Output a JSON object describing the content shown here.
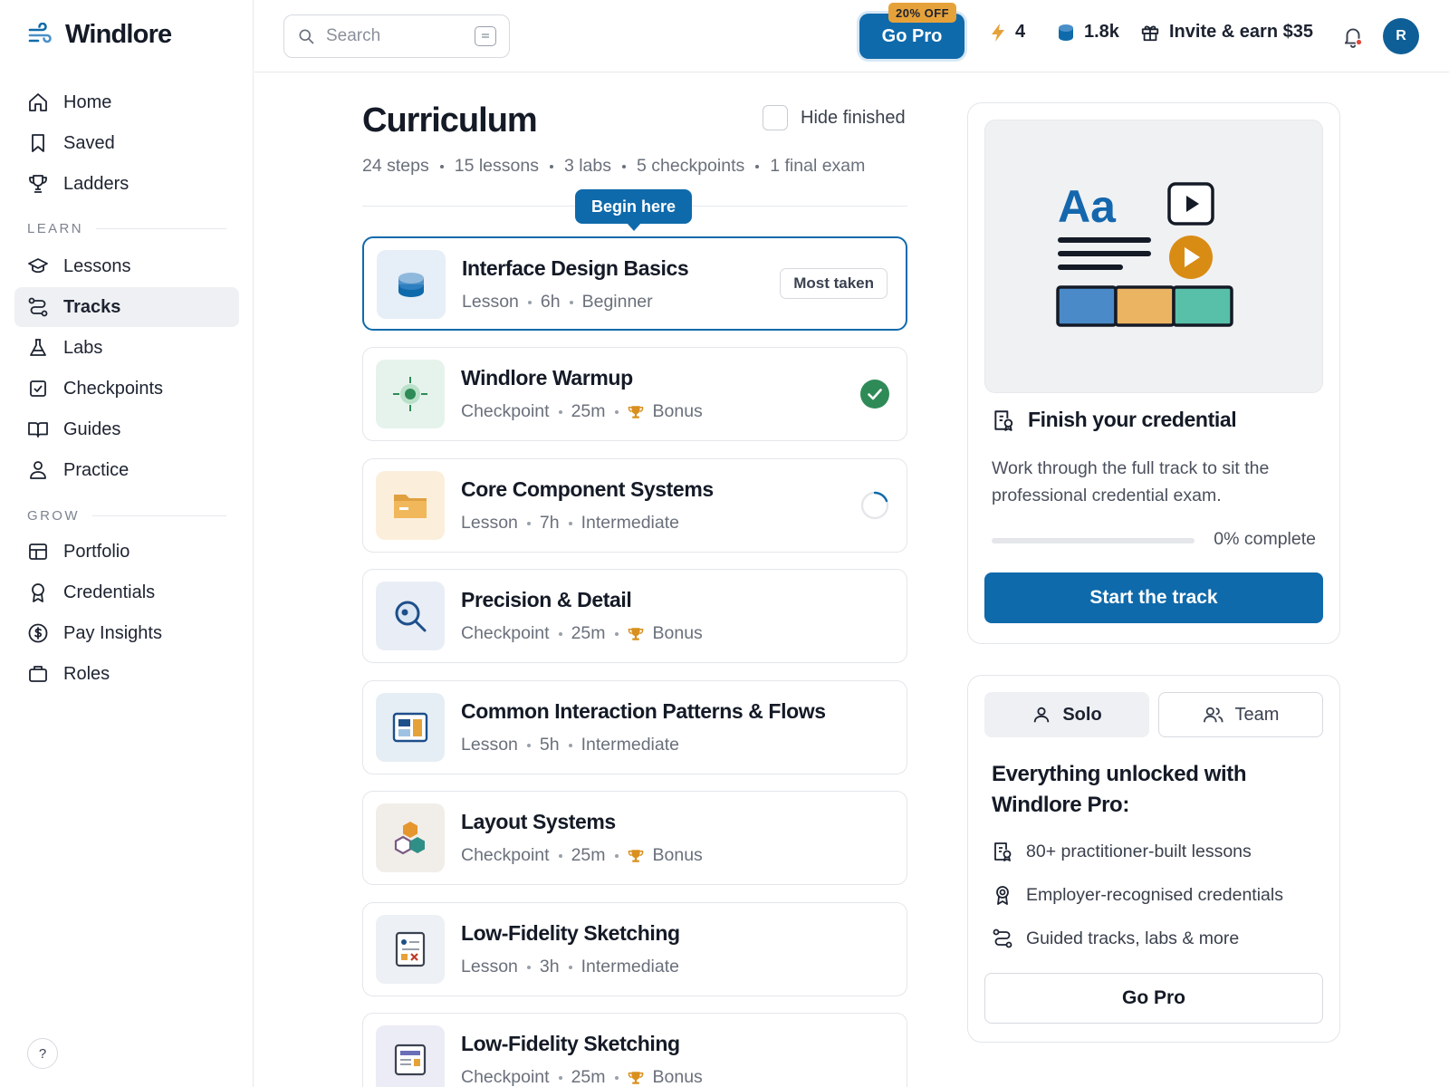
{
  "app": {
    "name": "Windlore"
  },
  "sidebar": {
    "primary": [
      {
        "label": "Home",
        "icon": "home-icon"
      },
      {
        "label": "Saved",
        "icon": "bookmark-icon"
      },
      {
        "label": "Ladders",
        "icon": "trophy-icon"
      }
    ],
    "learn_label": "LEARN",
    "learn": [
      {
        "label": "Lessons",
        "icon": "graduation-cap-icon"
      },
      {
        "label": "Tracks",
        "icon": "route-icon",
        "active": true
      },
      {
        "label": "Labs",
        "icon": "flask-icon"
      },
      {
        "label": "Checkpoints",
        "icon": "checkbox-icon"
      },
      {
        "label": "Guides",
        "icon": "book-open-icon"
      },
      {
        "label": "Practice",
        "icon": "person-icon"
      }
    ],
    "grow_label": "GROW",
    "grow": [
      {
        "label": "Portfolio",
        "icon": "layout-icon"
      },
      {
        "label": "Credentials",
        "icon": "award-icon"
      },
      {
        "label": "Pay Insights",
        "icon": "dollar-circle-icon"
      },
      {
        "label": "Roles",
        "icon": "briefcase-icon"
      }
    ],
    "help": "?"
  },
  "topbar": {
    "search_placeholder": "Search",
    "go_pro": "Go Pro",
    "go_pro_badge": "20% OFF",
    "streak": "4",
    "coins": "1.8k",
    "invite": "Invite & earn $35",
    "avatar_initial": "R"
  },
  "curriculum": {
    "title": "Curriculum",
    "hide_finished": "Hide finished",
    "summary": [
      "24 steps",
      "15 lessons",
      "3 labs",
      "5 checkpoints",
      "1 final exam"
    ],
    "begin_here": "Begin here",
    "items": [
      {
        "title": "Interface Design Basics",
        "meta": [
          "Lesson",
          "6h",
          "Beginner"
        ],
        "badge": "Most taken",
        "status": "none",
        "highlight": true
      },
      {
        "title": "Windlore Warmup",
        "meta": [
          "Checkpoint",
          "25m",
          "Bonus"
        ],
        "bonus": true,
        "status": "done"
      },
      {
        "title": "Core Component Systems",
        "meta": [
          "Lesson",
          "7h",
          "Intermediate"
        ],
        "status": "in-progress"
      },
      {
        "title": "Precision & Detail",
        "meta": [
          "Checkpoint",
          "25m",
          "Bonus"
        ],
        "bonus": true,
        "status": "none"
      },
      {
        "title": "Common Interaction Patterns & Flows",
        "meta": [
          "Lesson",
          "5h",
          "Intermediate"
        ],
        "status": "none"
      },
      {
        "title": "Layout Systems",
        "meta": [
          "Checkpoint",
          "25m",
          "Bonus"
        ],
        "bonus": true,
        "status": "none"
      },
      {
        "title": "Low-Fidelity Sketching",
        "meta": [
          "Lesson",
          "3h",
          "Intermediate"
        ],
        "status": "none"
      },
      {
        "title": "Low-Fidelity Sketching",
        "meta": [
          "Checkpoint",
          "25m",
          "Bonus"
        ],
        "bonus": true,
        "status": "none"
      }
    ]
  },
  "credential_panel": {
    "illustration_text": "Aa",
    "heading": "Finish your credential",
    "description": "Work through the full track to sit the professional credential exam.",
    "progress": 0,
    "progress_text": "0% complete",
    "cta": "Start the track"
  },
  "pro_panel": {
    "tabs": [
      "Solo",
      "Team"
    ],
    "active_tab": "Solo",
    "title": "Everything unlocked with Windlore Pro:",
    "features": [
      {
        "text": "80+ practitioner-built lessons",
        "icon": "lesson-doc-icon"
      },
      {
        "text": "Employer-recognised credentials",
        "icon": "award-icon"
      },
      {
        "text": "Guided tracks, labs & more",
        "icon": "route-icon"
      }
    ],
    "cta": "Go Pro"
  },
  "colors": {
    "accent": "#0f6aab",
    "success": "#2e8b57",
    "gold": "#e6a23a",
    "teal": "#4fb8a3"
  }
}
